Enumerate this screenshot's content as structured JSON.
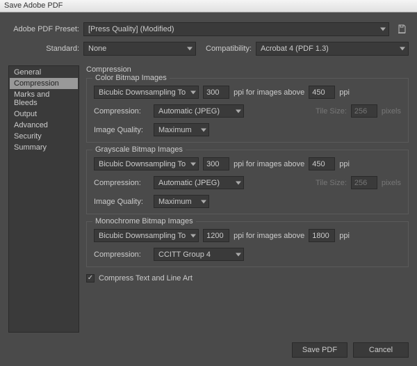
{
  "title": "Save Adobe PDF",
  "preset": {
    "label": "Adobe PDF Preset:",
    "value": "[Press Quality] (Modified)"
  },
  "standard": {
    "label": "Standard:",
    "value": "None"
  },
  "compat": {
    "label": "Compatibility:",
    "value": "Acrobat 4 (PDF 1.3)"
  },
  "sidebar": {
    "items": [
      "General",
      "Compression",
      "Marks and Bleeds",
      "Output",
      "Advanced",
      "Security",
      "Summary"
    ],
    "selected": 1
  },
  "section": "Compression",
  "groups": {
    "color": {
      "legend": "Color Bitmap Images",
      "method": "Bicubic Downsampling To",
      "ppi": "300",
      "above_label": "ppi for images above",
      "above": "450",
      "ppi_suffix": "ppi",
      "comp_label": "Compression:",
      "comp": "Automatic (JPEG)",
      "tile_label": "Tile Size:",
      "tile": "256",
      "pixels": "pixels",
      "quality_label": "Image Quality:",
      "quality": "Maximum"
    },
    "gray": {
      "legend": "Grayscale Bitmap Images",
      "method": "Bicubic Downsampling To",
      "ppi": "300",
      "above_label": "ppi for images above",
      "above": "450",
      "ppi_suffix": "ppi",
      "comp_label": "Compression:",
      "comp": "Automatic (JPEG)",
      "tile_label": "Tile Size:",
      "tile": "256",
      "pixels": "pixels",
      "quality_label": "Image Quality:",
      "quality": "Maximum"
    },
    "mono": {
      "legend": "Monochrome Bitmap Images",
      "method": "Bicubic Downsampling To",
      "ppi": "1200",
      "above_label": "ppi for images above",
      "above": "1800",
      "ppi_suffix": "ppi",
      "comp_label": "Compression:",
      "comp": "CCITT Group 4"
    }
  },
  "compress_text": {
    "label": "Compress Text and Line Art",
    "checked": true
  },
  "buttons": {
    "save": "Save PDF",
    "cancel": "Cancel"
  }
}
